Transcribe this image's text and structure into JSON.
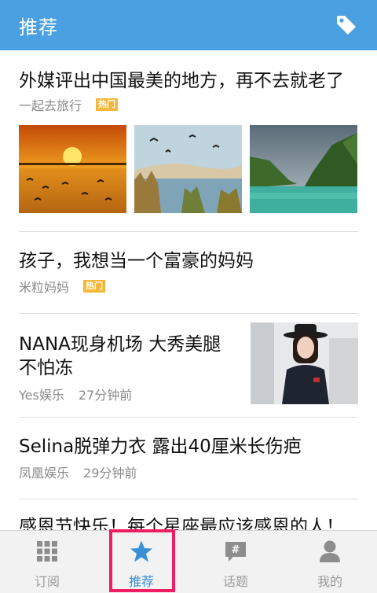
{
  "header": {
    "title": "推荐",
    "icon": "tag-icon"
  },
  "articles": [
    {
      "title": "外媒评出中国最美的地方，再不去就老了",
      "source": "一起去旅行",
      "badge": "热门"
    },
    {
      "title": "孩子，我想当一个富豪的妈妈",
      "source": "米粒妈妈",
      "badge": "热门"
    },
    {
      "title": "NANA现身机场 大秀美腿不怕冻",
      "source": "Yes娱乐",
      "time": "27分钟前"
    },
    {
      "title": "Selina脱弹力衣 露出40厘米长伤疤",
      "source": "凤凰娱乐",
      "time": "29分钟前"
    },
    {
      "title": "感恩节快乐！每个星座最应该感恩的人！"
    }
  ],
  "tabs": [
    {
      "label": "订阅",
      "icon": "grid-icon"
    },
    {
      "label": "推荐",
      "icon": "star-icon",
      "active": true
    },
    {
      "label": "话题",
      "icon": "hashtag-chat-icon"
    },
    {
      "label": "我的",
      "icon": "user-icon"
    }
  ],
  "colors": {
    "header": "#4aa0e0",
    "badge": "#f4b73a",
    "active_tab": "#3a8fd6",
    "highlight": "#ef1e63"
  }
}
